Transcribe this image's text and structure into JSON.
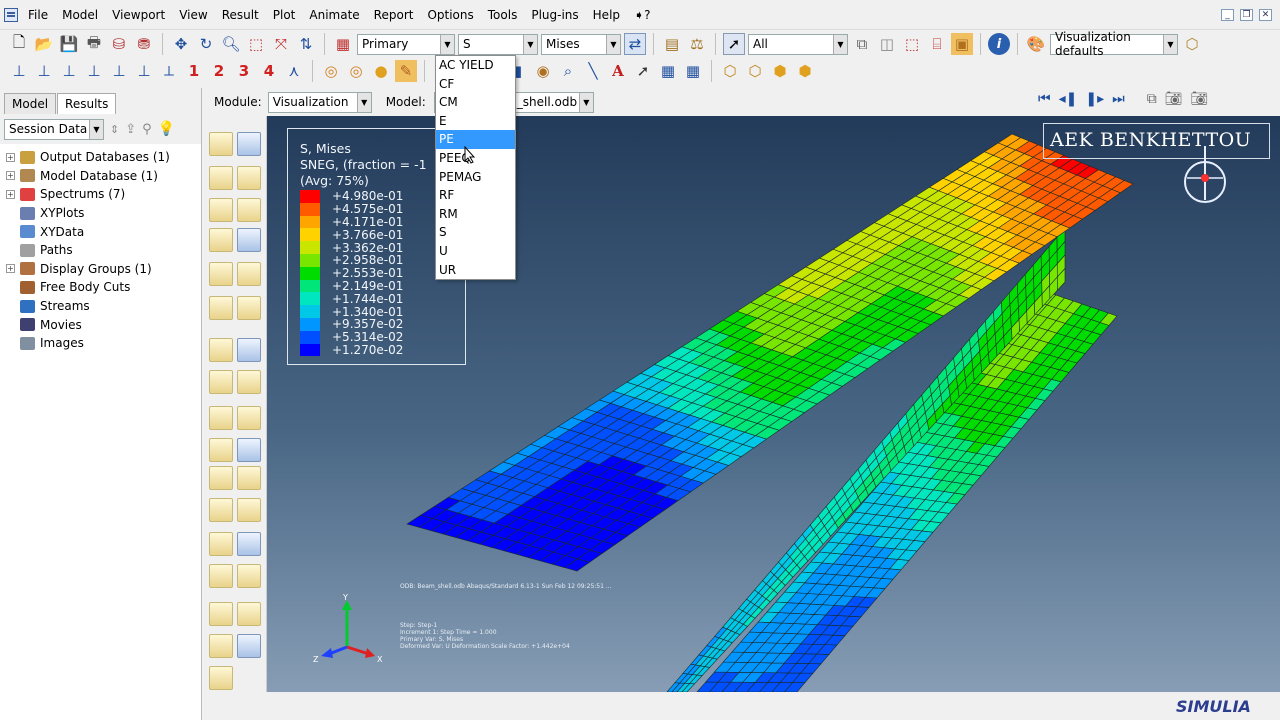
{
  "menu": [
    "File",
    "Model",
    "Viewport",
    "View",
    "Result",
    "Plot",
    "Animate",
    "Report",
    "Options",
    "Tools",
    "Plug-ins",
    "Help",
    "➧?"
  ],
  "toolbar": {
    "field_step": "Primary",
    "field_var": "S",
    "field_invariant": "Mises",
    "selection_filter": "All",
    "vis_defaults": "Visualization defaults",
    "nums": [
      "1",
      "2",
      "3",
      "4"
    ]
  },
  "dropdown": {
    "items": [
      "AC YIELD",
      "CF",
      "CM",
      "E",
      "PE",
      "PEEQ",
      "PEMAG",
      "RF",
      "RM",
      "S",
      "U",
      "UR"
    ],
    "selected_index": 4
  },
  "left_panel": {
    "tabs": [
      "Model",
      "Results"
    ],
    "active_tab": "Results",
    "session_label": "Session Data",
    "tree": [
      {
        "label": "Output Databases (1)",
        "expandable": true,
        "icon": "output-db-icon",
        "color": "#c8a040"
      },
      {
        "label": "Model Database (1)",
        "expandable": true,
        "icon": "model-db-icon",
        "color": "#b08850"
      },
      {
        "label": "Spectrums (7)",
        "expandable": true,
        "icon": "spectrum-icon",
        "color": "#e04040"
      },
      {
        "label": "XYPlots",
        "expandable": false,
        "icon": "xyplot-icon",
        "color": "#6a7fb0"
      },
      {
        "label": "XYData",
        "expandable": false,
        "icon": "xydata-icon",
        "color": "#5a8ad0"
      },
      {
        "label": "Paths",
        "expandable": false,
        "icon": "path-icon",
        "color": "#a0a0a0"
      },
      {
        "label": "Display Groups (1)",
        "expandable": true,
        "icon": "display-groups-icon",
        "color": "#b07040"
      },
      {
        "label": "Free Body Cuts",
        "expandable": false,
        "icon": "free-body-icon",
        "color": "#a06030"
      },
      {
        "label": "Streams",
        "expandable": false,
        "icon": "stream-icon",
        "color": "#3070c0"
      },
      {
        "label": "Movies",
        "expandable": false,
        "icon": "movie-icon",
        "color": "#404070"
      },
      {
        "label": "Images",
        "expandable": false,
        "icon": "image-icon",
        "color": "#8090a0"
      }
    ]
  },
  "module_bar": {
    "module_label": "Module:",
    "module_value": "Visualization",
    "model_label": "Model:",
    "model_value": "_shell.odb"
  },
  "legend": {
    "title": "S, Mises",
    "subtitle": "SNEG, (fraction = -1",
    "avg": "(Avg: 75%)",
    "values": [
      "+4.980e-01",
      "+4.575e-01",
      "+4.171e-01",
      "+3.766e-01",
      "+3.362e-01",
      "+2.958e-01",
      "+2.553e-01",
      "+2.149e-01",
      "+1.744e-01",
      "+1.340e-01",
      "+9.357e-02",
      "+5.314e-02",
      "+1.270e-02"
    ],
    "colors": [
      "#ff0000",
      "#ff5a00",
      "#ffa500",
      "#ffd200",
      "#c8e600",
      "#78e600",
      "#00dc00",
      "#00e678",
      "#00e6be",
      "#00c8e6",
      "#0096ff",
      "#0050ff",
      "#0000ff"
    ]
  },
  "watermark": "AEK BENKHETTOU",
  "odb_text": {
    "line1": "ODB: Beam_shell.odb    Abaqus/Standard 6.13-1    Sun Feb 12 09:25:51 ...",
    "line2": "Step: Step-1",
    "line3": "Increment    1: Step Time =    1.000",
    "line4": "Primary Var: S, Mises",
    "line5": "Deformed Var: U   Deformation Scale Factor: +1.442e+04"
  },
  "triad": {
    "x": "X",
    "y": "Y",
    "z": "Z"
  },
  "brand": "SIMULIA",
  "colors": {
    "accent": "#3399ff",
    "viewport_top": "#233b5a",
    "viewport_bottom": "#879db5"
  }
}
